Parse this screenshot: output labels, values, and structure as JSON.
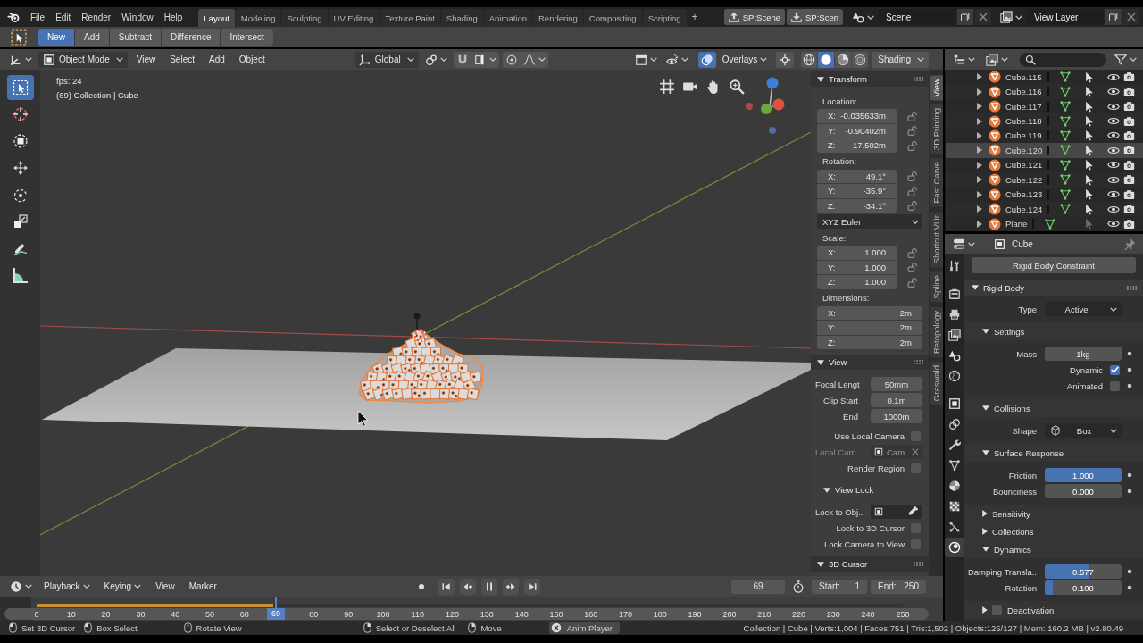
{
  "topbar": {
    "menus": [
      "File",
      "Edit",
      "Render",
      "Window",
      "Help"
    ],
    "workspaces": [
      {
        "label": "Layout",
        "selected": true
      },
      {
        "label": "Modeling",
        "selected": false
      },
      {
        "label": "Sculpting",
        "selected": false
      },
      {
        "label": "UV Editing",
        "selected": false
      },
      {
        "label": "Texture Paint",
        "selected": false
      },
      {
        "label": "Shading",
        "selected": false
      },
      {
        "label": "Animation",
        "selected": false
      },
      {
        "label": "Rendering",
        "selected": false
      },
      {
        "label": "Compositing",
        "selected": false
      },
      {
        "label": "Scripting",
        "selected": false
      }
    ],
    "add_workspace": "+",
    "scene_buttons": [
      {
        "kind": "upload",
        "label": "SP:Scene"
      },
      {
        "kind": "download",
        "label": "SP:Scen"
      }
    ],
    "scene": "Scene",
    "view_layer": "View Layer"
  },
  "tool_header": {
    "modes": [
      {
        "label": "New",
        "selected": true
      },
      {
        "label": "Add",
        "selected": false
      },
      {
        "label": "Subtract",
        "selected": false
      },
      {
        "label": "Difference",
        "selected": false
      },
      {
        "label": "Intersect",
        "selected": false
      }
    ]
  },
  "viewport_header": {
    "mode": "Object Mode",
    "menus": [
      "View",
      "Select",
      "Add",
      "Object"
    ],
    "orientation": "Global",
    "snapping": {
      "on": false
    },
    "proportional_editing": {
      "on": false
    },
    "overlays": {
      "label": "Overlays",
      "on": true
    },
    "shading_modes": [
      {
        "kind": "wireframe",
        "selected": false
      },
      {
        "kind": "solid",
        "selected": true
      },
      {
        "kind": "material",
        "selected": false
      },
      {
        "kind": "rendered",
        "selected": false
      }
    ],
    "shading": "Shading"
  },
  "viewport": {
    "tools": [
      {
        "kind": "select",
        "selected": true
      },
      {
        "kind": "cursor",
        "selected": false
      },
      {
        "kind": "transform",
        "selected": false
      },
      {
        "kind": "move",
        "selected": false
      },
      {
        "kind": "rotate",
        "selected": false
      },
      {
        "kind": "scale",
        "selected": false
      },
      {
        "kind": "annotate",
        "selected": false
      },
      {
        "kind": "measure",
        "selected": false
      }
    ],
    "stats": [
      "fps: 24",
      "(69) Collection | Cube"
    ]
  },
  "sidebar": {
    "tabs": [
      {
        "label": "View",
        "selected": true
      },
      {
        "label": "3D Printing",
        "selected": false
      },
      {
        "label": "Fast Carve",
        "selected": false
      },
      {
        "label": "Shortcut VUr",
        "selected": false
      },
      {
        "label": "Spline",
        "selected": false
      },
      {
        "label": "Retopology",
        "selected": false
      },
      {
        "label": "Graswald",
        "selected": false
      }
    ],
    "panels": [
      {
        "title": "Transform",
        "expanded": true,
        "items": [
          {
            "kind": "heading",
            "text": "Location:"
          },
          {
            "kind": "vector",
            "fields": [
              {
                "axis": "X:",
                "value": "-0.035633m",
                "locked": false
              },
              {
                "axis": "Y:",
                "value": "-0.90402m",
                "locked": false
              },
              {
                "axis": "Z:",
                "value": "17.502m",
                "locked": false
              }
            ]
          },
          {
            "kind": "heading",
            "text": "Rotation:"
          },
          {
            "kind": "vector",
            "fields": [
              {
                "axis": "X:",
                "value": "49.1°",
                "locked": false
              },
              {
                "axis": "Y:",
                "value": "-35.9°",
                "locked": false
              },
              {
                "axis": "Z:",
                "value": "-34.1°",
                "locked": false
              }
            ]
          },
          {
            "kind": "dropdown",
            "value": "XYZ Euler"
          },
          {
            "kind": "heading",
            "text": "Scale:"
          },
          {
            "kind": "vector",
            "fields": [
              {
                "axis": "X:",
                "value": "1.000",
                "locked": false
              },
              {
                "axis": "Y:",
                "value": "1.000",
                "locked": false
              },
              {
                "axis": "Z:",
                "value": "1.000",
                "locked": false
              }
            ]
          },
          {
            "kind": "heading",
            "text": "Dimensions:"
          },
          {
            "kind": "vector",
            "fields": [
              {
                "axis": "X:",
                "value": "2m"
              },
              {
                "axis": "Y:",
                "value": "2m"
              },
              {
                "axis": "Z:",
                "value": "2m"
              }
            ]
          }
        ]
      },
      {
        "title": "View",
        "expanded": true,
        "items": [
          {
            "kind": "number",
            "label": "Focal Lengt",
            "value": "50mm"
          },
          {
            "kind": "number",
            "label": "Clip Start",
            "value": "0.1m"
          },
          {
            "kind": "number",
            "label": "End",
            "value": "1000m"
          },
          {
            "kind": "checkbox",
            "label": "Use Local Camera",
            "checked": false
          },
          {
            "kind": "object",
            "label": "Local Cam..",
            "value": "Cam",
            "disabled": true
          },
          {
            "kind": "checkbox",
            "label": "Render Region",
            "checked": false
          },
          {
            "kind": "subpanel",
            "title": "View Lock",
            "expanded": true,
            "items": [
              {
                "kind": "object",
                "label": "Lock to Obj..",
                "disabled": false
              },
              {
                "kind": "checkbox",
                "label": "Lock to 3D Cursor",
                "checked": false
              },
              {
                "kind": "checkbox",
                "label": "Lock Camera to View",
                "checked": false
              }
            ]
          }
        ]
      },
      {
        "title": "3D Cursor",
        "expanded": true
      }
    ]
  },
  "outliner": {
    "rows": [
      {
        "name": "Cube.115",
        "expanded": false,
        "selected": false,
        "selectable": true
      },
      {
        "name": "Cube.116",
        "expanded": false,
        "selected": false,
        "selectable": true
      },
      {
        "name": "Cube.117",
        "expanded": false,
        "selected": false,
        "selectable": true
      },
      {
        "name": "Cube.118",
        "expanded": false,
        "selected": false,
        "selectable": true
      },
      {
        "name": "Cube.119",
        "expanded": false,
        "selected": false,
        "selectable": true
      },
      {
        "name": "Cube.120",
        "expanded": false,
        "selected": true,
        "selectable": true
      },
      {
        "name": "Cube.121",
        "expanded": false,
        "selected": false,
        "selectable": true
      },
      {
        "name": "Cube.122",
        "expanded": false,
        "selected": false,
        "selectable": true
      },
      {
        "name": "Cube.123",
        "expanded": false,
        "selected": false,
        "selectable": true
      },
      {
        "name": "Cube.124",
        "expanded": false,
        "selected": false,
        "selectable": true
      },
      {
        "name": "Plane",
        "expanded": false,
        "selected": false,
        "selectable": false
      }
    ]
  },
  "properties": {
    "object": "Cube",
    "tabs": [
      {
        "kind": "tool",
        "selected": false
      },
      {
        "kind": "render",
        "selected": false
      },
      {
        "kind": "output",
        "selected": false
      },
      {
        "kind": "view_layer",
        "selected": false
      },
      {
        "kind": "scene",
        "selected": false
      },
      {
        "kind": "world",
        "selected": false
      },
      {
        "kind": "object",
        "selected": false
      },
      {
        "kind": "constraint",
        "selected": false
      },
      {
        "kind": "modifier",
        "selected": false
      },
      {
        "kind": "data",
        "selected": false
      },
      {
        "kind": "material",
        "selected": false
      },
      {
        "kind": "texture",
        "selected": false
      },
      {
        "kind": "particles",
        "selected": false
      },
      {
        "kind": "physics",
        "selected": true
      }
    ],
    "button": "Rigid Body Constraint",
    "panels": [
      {
        "title": "Rigid Body",
        "expanded": true,
        "items": [
          {
            "kind": "dropdown",
            "label": "Type",
            "value": "Active"
          },
          {
            "kind": "subpanel",
            "title": "Settings",
            "expanded": true,
            "items": [
              {
                "kind": "number",
                "label": "Mass",
                "value": "1kg"
              },
              {
                "kind": "checkbox",
                "label": "Dynamic",
                "checked": true
              },
              {
                "kind": "checkbox",
                "label": "Animated",
                "checked": false
              }
            ]
          },
          {
            "kind": "subpanel",
            "title": "Collisions",
            "expanded": true,
            "items": [
              {
                "kind": "shape_dropdown",
                "label": "Shape",
                "value": "Box"
              }
            ]
          },
          {
            "kind": "subpanel",
            "title": "Surface Response",
            "expanded": true,
            "items": [
              {
                "kind": "slider",
                "label": "Friction",
                "value": "1.000",
                "level": 1
              },
              {
                "kind": "slider",
                "label": "Bounciness",
                "value": "0.000"
              }
            ]
          },
          {
            "kind": "subpanel",
            "title": "Sensitivity",
            "expanded": false
          },
          {
            "kind": "subpanel",
            "title": "Collections",
            "expanded": false
          },
          {
            "kind": "subpanel",
            "title": "Dynamics",
            "expanded": true,
            "items": [
              {
                "kind": "slider",
                "label": "Damping Transla..",
                "value": "0.577",
                "level": 0.577
              },
              {
                "kind": "slider",
                "label": "Rotation",
                "value": "0.100",
                "level": 0.1
              }
            ]
          },
          {
            "kind": "subpanel",
            "title": "Deactivation",
            "expanded": false,
            "checked": false
          }
        ]
      }
    ]
  },
  "timeline": {
    "menus": [
      {
        "label": "Playback",
        "dropdown": true
      },
      {
        "label": "Keying",
        "dropdown": true
      },
      {
        "label": "View",
        "dropdown": false
      },
      {
        "label": "Marker",
        "dropdown": false
      }
    ],
    "controls": [
      {
        "kind": "record"
      },
      {
        "kind": "jump_start"
      },
      {
        "kind": "prev_key"
      },
      {
        "kind": "pause"
      },
      {
        "kind": "next_key"
      },
      {
        "kind": "jump_end"
      }
    ],
    "current_frame": "69",
    "start": {
      "label": "Start:",
      "value": "1"
    },
    "end": {
      "label": "End:",
      "value": "250"
    },
    "ruler": {
      "before_playhead": [
        "0",
        "10",
        "20",
        "30",
        "40",
        "50",
        "60"
      ],
      "after_playhead": [
        "80",
        "90",
        "100",
        "110",
        "120",
        "130",
        "140",
        "150",
        "160",
        "170",
        "180",
        "190",
        "200",
        "210",
        "220",
        "230",
        "240",
        "250"
      ]
    },
    "cache": {
      "level": 0.273
    },
    "playhead": {
      "label": "69",
      "level": 0.276
    }
  },
  "status_bar": {
    "hints": [
      {
        "kind": "left",
        "label": "Set 3D Cursor"
      },
      {
        "kind": "left_drag",
        "label": "Box Select"
      },
      {
        "kind": "middle",
        "label": "Rotate View"
      },
      {
        "kind": "right",
        "label": "Select or Deselect All"
      },
      {
        "kind": "right_drag",
        "label": "Move"
      }
    ],
    "job": "Anim Player",
    "stats": "Collection | Cube | Verts:1,004 | Faces:751 | Tris:1,502 | Objects:125/127 | Mem: 160.2 MB | v2.80.49"
  }
}
